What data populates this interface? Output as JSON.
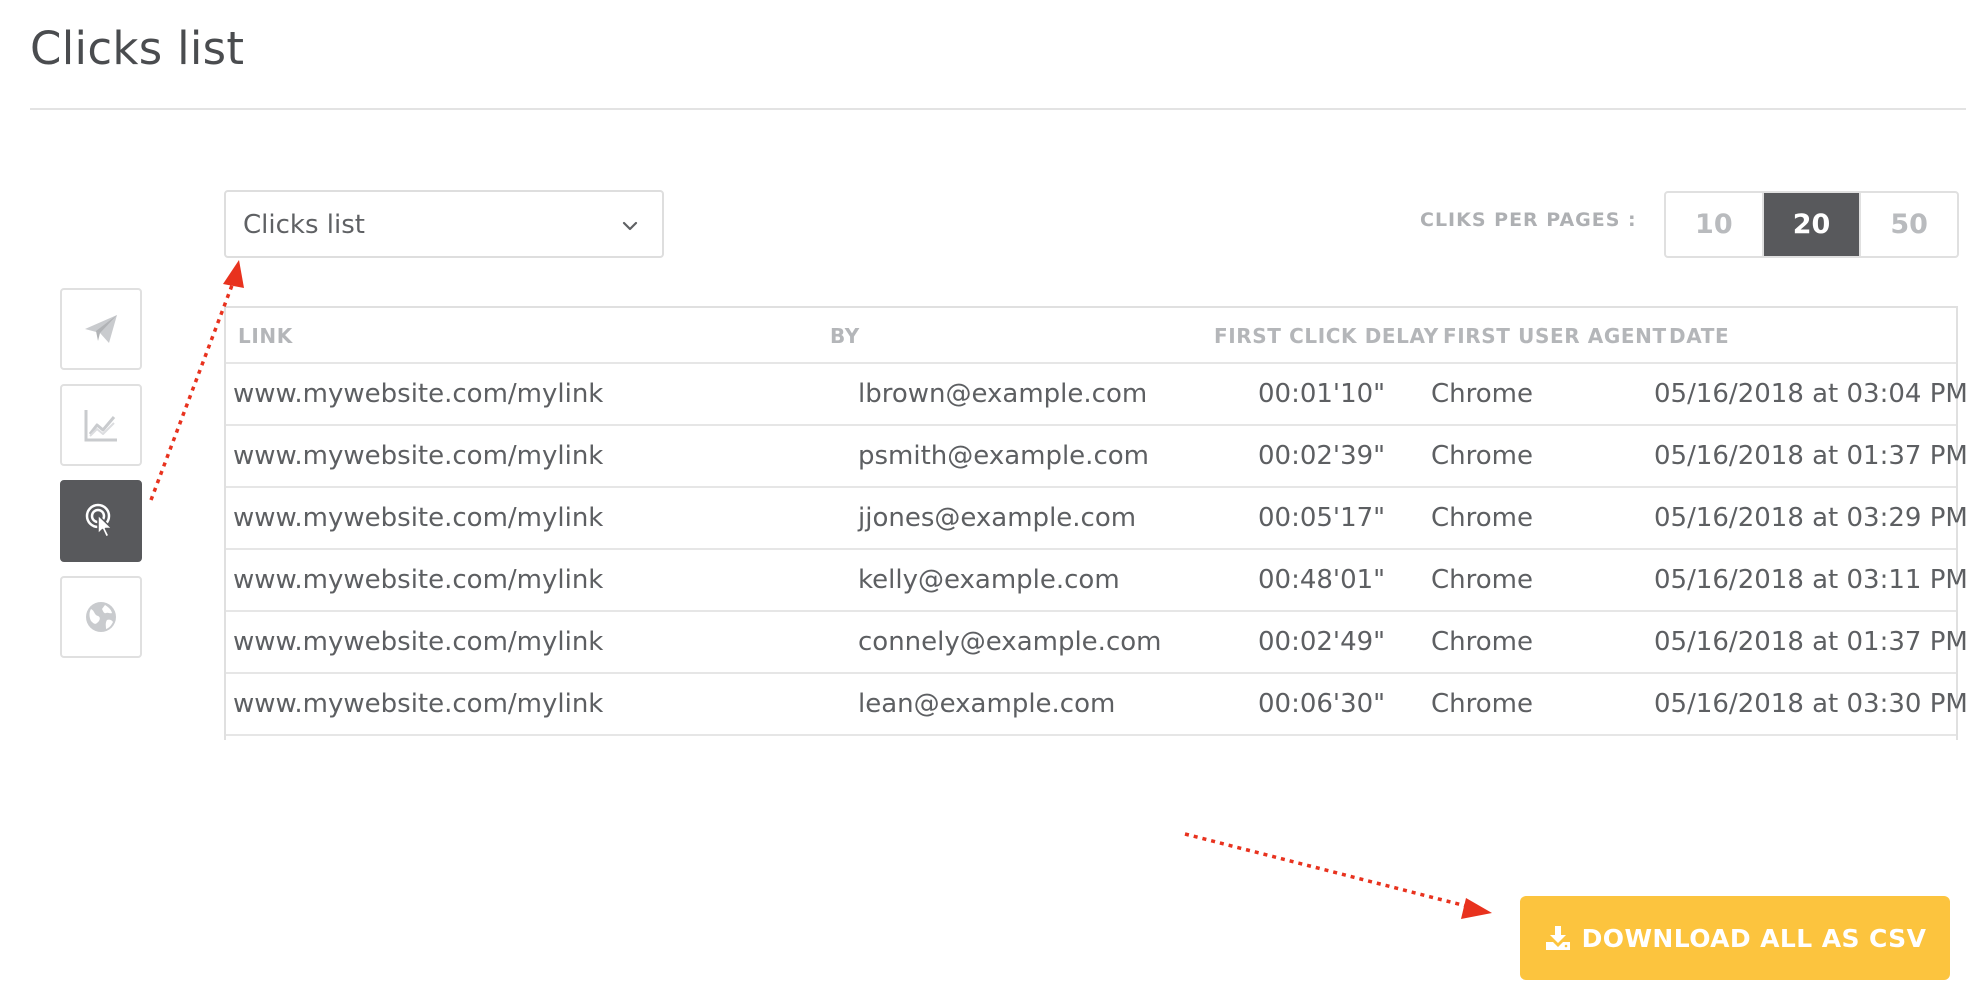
{
  "page": {
    "title": "Clicks list"
  },
  "rail": {
    "items": [
      {
        "icon": "paper-plane-icon",
        "active": false
      },
      {
        "icon": "line-chart-icon",
        "active": false
      },
      {
        "icon": "pointer-click-icon",
        "active": true
      },
      {
        "icon": "globe-icon",
        "active": false
      }
    ]
  },
  "view_select": {
    "value": "Clicks list",
    "icon": "chevron-down-icon"
  },
  "per_page": {
    "label": "CLIKS PER PAGES :",
    "options": [
      "10",
      "20",
      "50"
    ],
    "selected": "20"
  },
  "table": {
    "headers": {
      "link": "LINK",
      "by": "BY",
      "delay": "FIRST CLICK DELAY",
      "agent": "FIRST USER AGENT",
      "date": "DATE"
    },
    "rows": [
      {
        "link": "www.mywebsite.com/mylink",
        "by": "lbrown@example.com",
        "delay": "00:01'10\"",
        "agent": "Chrome",
        "date": "05/16/2018 at 03:04 PM"
      },
      {
        "link": "www.mywebsite.com/mylink",
        "by": "psmith@example.com",
        "delay": "00:02'39\"",
        "agent": "Chrome",
        "date": "05/16/2018 at 01:37 PM"
      },
      {
        "link": "www.mywebsite.com/mylink",
        "by": "jjones@example.com",
        "delay": "00:05'17\"",
        "agent": "Chrome",
        "date": "05/16/2018 at 03:29 PM"
      },
      {
        "link": "www.mywebsite.com/mylink",
        "by": "kelly@example.com",
        "delay": "00:48'01\"",
        "agent": "Chrome",
        "date": "05/16/2018 at 03:11 PM"
      },
      {
        "link": "www.mywebsite.com/mylink",
        "by": "connely@example.com",
        "delay": "00:02'49\"",
        "agent": "Chrome",
        "date": "05/16/2018 at 01:37 PM"
      },
      {
        "link": "www.mywebsite.com/mylink",
        "by": "lean@example.com",
        "delay": "00:06'30\"",
        "agent": "Chrome",
        "date": "05/16/2018 at 03:30 PM"
      }
    ]
  },
  "download": {
    "label": "DOWNLOAD ALL AS CSV",
    "icon": "download-icon"
  },
  "colors": {
    "accent": "#fcc43e",
    "active": "#58595c",
    "annotation": "#e8321e"
  }
}
